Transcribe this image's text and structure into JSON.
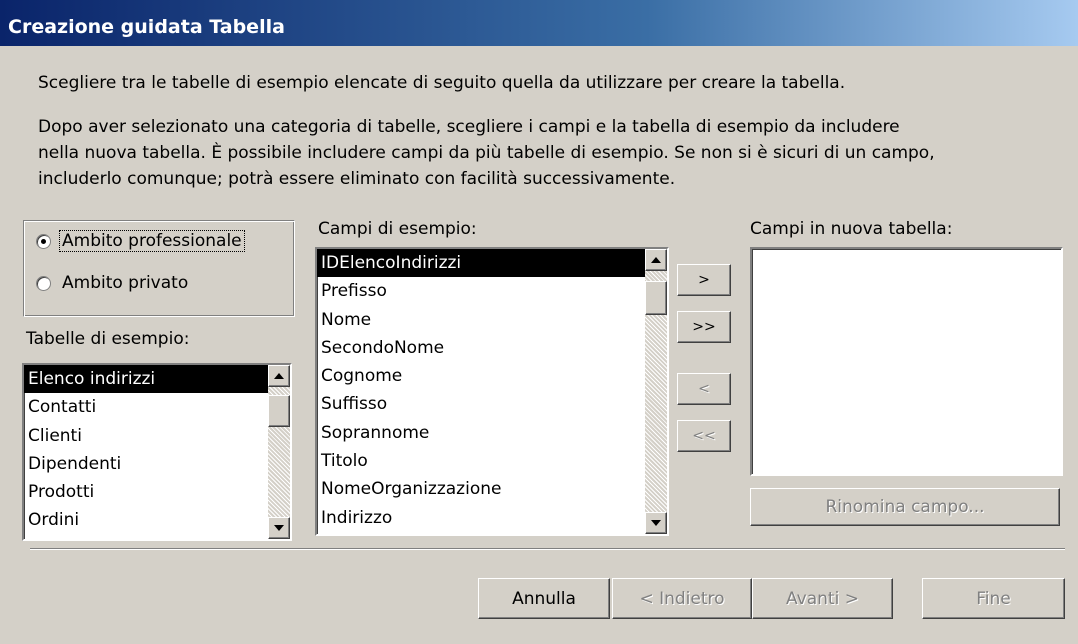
{
  "window": {
    "title": "Creazione guidata Tabella"
  },
  "intro": {
    "line1": "Scegliere tra le tabelle di esempio elencate di seguito quella da utilizzare per creare la tabella.",
    "line2": "Dopo aver selezionato una categoria di tabelle, scegliere i campi e la tabella di esempio da includere",
    "line3": "nella nuova tabella. È possibile includere campi da più tabelle di esempio. Se non si è sicuri di un campo,",
    "line4": "includerlo comunque; potrà essere eliminato con facilità successivamente."
  },
  "category": {
    "options": [
      "Ambito professionale",
      "Ambito privato"
    ],
    "selected": "Ambito professionale"
  },
  "sample_tables": {
    "label": "Tabelle di esempio:",
    "items": [
      "Elenco indirizzi",
      "Contatti",
      "Clienti",
      "Dipendenti",
      "Prodotti",
      "Ordini"
    ],
    "selected": "Elenco indirizzi"
  },
  "sample_fields": {
    "label": "Campi di esempio:",
    "items": [
      "IDElencoIndirizzi",
      "Prefisso",
      "Nome",
      "SecondoNome",
      "Cognome",
      "Suffisso",
      "Soprannome",
      "Titolo",
      "NomeOrganizzazione",
      "Indirizzo"
    ],
    "selected": "IDElencoIndirizzi"
  },
  "move_buttons": {
    "add_one": ">",
    "add_all": ">>",
    "remove_one": "<",
    "remove_all": "<<"
  },
  "new_fields": {
    "label": "Campi in nuova tabella:",
    "items": [],
    "rename_label": "Rinomina campo..."
  },
  "footer": {
    "cancel": "Annulla",
    "back": "< Indietro",
    "next": "Avanti >",
    "finish": "Fine"
  }
}
